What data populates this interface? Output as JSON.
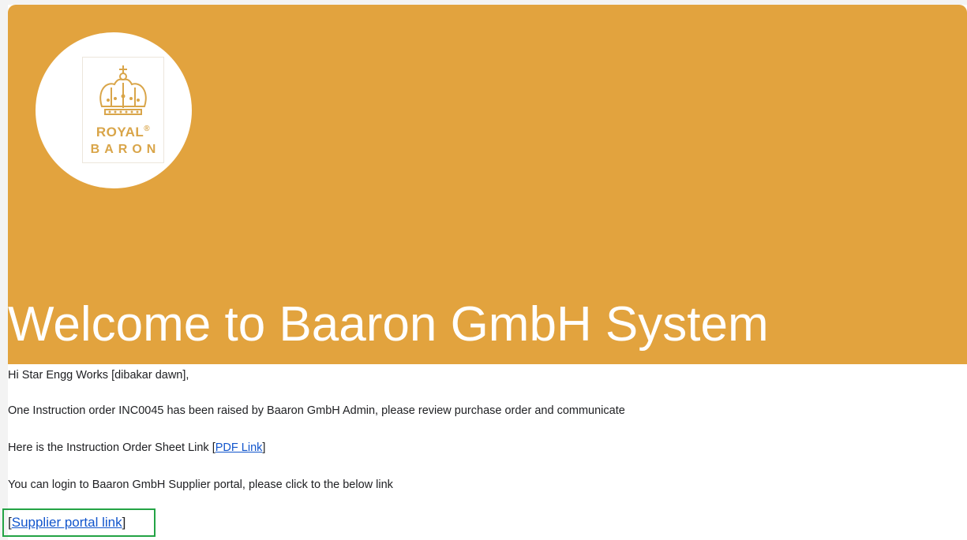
{
  "banner": {
    "color": "#e2a33e",
    "logo": {
      "icon": "crown-icon",
      "line1": "ROYAL",
      "mark": "®",
      "line2": "BARON"
    },
    "welcome_text": "Welcome to Baaron GmbH System"
  },
  "body": {
    "greeting": "Hi Star Engg Works [dibakar dawn],",
    "message": "One Instruction order INC0045 has been raised by Baaron GmbH Admin, please review purchase order and communicate",
    "sheet_prefix": "Here is the Instruction Order Sheet Link [",
    "pdf_link": "PDF Link",
    "sheet_suffix": "]",
    "login_text": "You can login to Baaron GmbH Supplier portal, please click to the below link",
    "portal_open": "[",
    "portal_link": "Supplier portal link",
    "portal_close": "]"
  },
  "colors": {
    "link": "#1155cc",
    "highlight": "#23a345"
  }
}
